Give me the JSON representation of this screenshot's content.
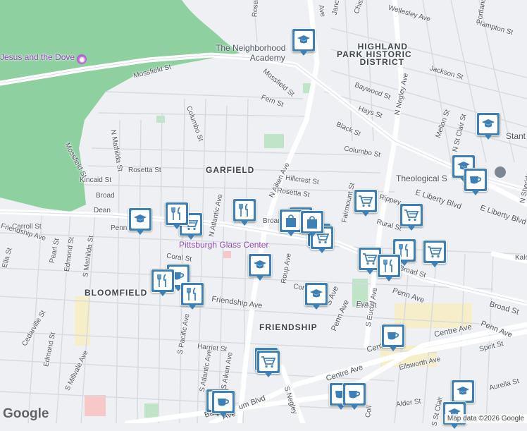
{
  "map": {
    "neighborhoods": [
      {
        "id": "highland-park",
        "text": "HIGHLAND PARK HISTORIC DISTRICT",
        "lines": [
          "HIGHLAND",
          "PARK HISTORIC",
          "DISTRICT"
        ]
      },
      {
        "id": "garfield",
        "text": "GARFIELD"
      },
      {
        "id": "bloomfield",
        "text": "BLOOMFIELD"
      },
      {
        "id": "friendship",
        "text": "FRIENDSHIP"
      }
    ],
    "places": [
      {
        "id": "jesus-and-the-dove",
        "text": "Jesus and the Dove"
      },
      {
        "id": "neighborhood-academy",
        "lines": [
          "The Neighborhood",
          "Academy"
        ]
      },
      {
        "id": "pittsburgh-glass-center",
        "text": "Pittsburgh Glass Center"
      },
      {
        "id": "theological",
        "text": "Theological S"
      }
    ],
    "streets": [
      "Mossfield St",
      "Mossfield St",
      "Mossfield St",
      "Fern St",
      "Columbo St",
      "Columbo St",
      "N Mathilda St",
      "Rosetta St",
      "Rosetta St",
      "Kincaid St",
      "Broad",
      "Broad",
      "Dean",
      "Penn",
      "Carroll St",
      "Friendship Ave",
      "Pearl St",
      "Edmond St",
      "S Mathilda St",
      "Ella St",
      "Coral St",
      "N Atlantic Ave",
      "N Aiken Ave",
      "Roup Ave",
      "Hillcrest St",
      "Fairmount St",
      "Black St",
      "Hays St",
      "Baywood St",
      "Jackson St",
      "Hampton St",
      "Portland",
      "N Negley Ave",
      "Mellon St",
      "N St Clair St",
      "Stant",
      "Chislett",
      "Wellesley Ave",
      "Jancey",
      "Ave",
      "Rosel",
      "E Liberty Blvd",
      "E Liberty Blvd",
      "Rippey",
      "Rural St",
      "Kalo",
      "Broad St",
      "Broad St",
      "Penn Ave",
      "Penn Ave",
      "S Euclid Ave",
      "Eva St",
      "Cornwall",
      "S Pacific Ave",
      "S Atlantic Ave",
      "S Aiken Ave",
      "Harriet St",
      "S Millvale Ave",
      "Cedarville St",
      "Edmond St",
      "Centre Ave",
      "Centre Ave",
      "Spirit St",
      "Ellsworth Ave",
      "Aurelia St",
      "Alder St",
      "Coll",
      "um Blvd",
      "S Negley",
      "Penn Ave",
      "Centre Ave",
      "S St Clair",
      "Friendship Ave",
      "Baum",
      "Ave",
      "N Sheridan",
      "Eva",
      "S Ave",
      "Fa"
    ],
    "markers": [
      {
        "type": "school",
        "icon": "graduation-cap-icon"
      },
      {
        "type": "school",
        "icon": "graduation-cap-icon"
      },
      {
        "type": "school",
        "icon": "graduation-cap-icon"
      },
      {
        "type": "school",
        "icon": "graduation-cap-icon"
      },
      {
        "type": "school",
        "icon": "graduation-cap-icon"
      },
      {
        "type": "school",
        "icon": "graduation-cap-icon"
      },
      {
        "type": "school",
        "icon": "graduation-cap-icon"
      },
      {
        "type": "school",
        "icon": "graduation-cap-icon"
      },
      {
        "type": "cafe",
        "icon": "coffee-cup-icon"
      },
      {
        "type": "cafe",
        "icon": "coffee-cup-icon"
      },
      {
        "type": "cafe",
        "icon": "coffee-cup-icon"
      },
      {
        "type": "cafe",
        "icon": "coffee-cup-icon"
      },
      {
        "type": "cafe",
        "icon": "coffee-cup-icon"
      },
      {
        "type": "cafe",
        "icon": "coffee-cup-icon"
      },
      {
        "type": "cafe",
        "icon": "coffee-cup-icon"
      },
      {
        "type": "grocery",
        "icon": "shopping-cart-icon"
      },
      {
        "type": "grocery",
        "icon": "shopping-cart-icon"
      },
      {
        "type": "grocery",
        "icon": "shopping-cart-icon"
      },
      {
        "type": "grocery",
        "icon": "shopping-cart-icon"
      },
      {
        "type": "grocery",
        "icon": "shopping-cart-icon"
      },
      {
        "type": "grocery",
        "icon": "shopping-cart-icon"
      },
      {
        "type": "grocery",
        "icon": "shopping-cart-icon"
      },
      {
        "type": "grocery",
        "icon": "shopping-cart-icon"
      },
      {
        "type": "grocery",
        "icon": "shopping-cart-icon"
      },
      {
        "type": "grocery",
        "icon": "shopping-cart-icon"
      },
      {
        "type": "restaurant",
        "icon": "fork-knife-icon"
      },
      {
        "type": "restaurant",
        "icon": "fork-knife-icon"
      },
      {
        "type": "restaurant",
        "icon": "fork-knife-icon"
      },
      {
        "type": "restaurant",
        "icon": "fork-knife-icon"
      },
      {
        "type": "restaurant",
        "icon": "fork-knife-icon"
      },
      {
        "type": "restaurant",
        "icon": "fork-knife-icon"
      },
      {
        "type": "shopping",
        "icon": "shopping-bag-icon"
      },
      {
        "type": "shopping",
        "icon": "shopping-bag-icon"
      }
    ],
    "colors": {
      "marker": "#3d80b8",
      "park": "#8fd0a0",
      "road": "#ffffff",
      "background": "#eef0f3",
      "minor_road": "#d6dae0"
    }
  },
  "branding": {
    "logo": "Google",
    "attribution": "Map data ©2026 Google"
  }
}
